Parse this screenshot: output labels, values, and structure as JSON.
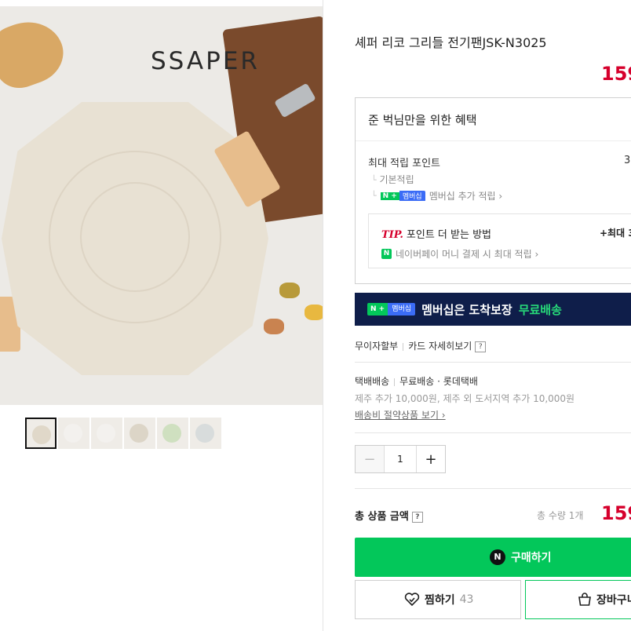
{
  "hero": {
    "brand_logo": "SSAPER"
  },
  "product": {
    "title": "셰퍼 리코 그리들 전기팬JSK-N3025",
    "price": "159"
  },
  "benefit": {
    "heading": "준 벅님만을 위한 혜택",
    "max_points_label": "최대 적립 포인트",
    "max_points_value": "3,",
    "basic_label": "기본적립",
    "npay_badge_n": "N +",
    "npay_badge_m": "멤버십",
    "membership_extra": "멤버십 추가 적립 ›",
    "tip_word": "TIP.",
    "tip_text": "포인트 더 받는 방법",
    "tip_value": "+최대 3",
    "tip_link": "네이버페이 머니 결제 시 최대 적립 ›"
  },
  "banner": {
    "badge_n": "N +",
    "badge_m": "멤버십",
    "text": "멤버십은 도착보장",
    "highlight": "무료배송"
  },
  "payment": {
    "installment": "무이자할부",
    "card_detail": "카드 자세히보기"
  },
  "shipping": {
    "method": "택배배송",
    "fee": "무료배송 · 롯데택배",
    "extra": "제주 추가 10,000원, 제주 외 도서지역 추가 10,000원",
    "saving_link": "배송비 절약상품 보기 ›"
  },
  "quantity": {
    "minus": "−",
    "value": "1",
    "plus": "+"
  },
  "total": {
    "label": "총 상품 금액",
    "qty_text": "총 수량 1개",
    "price": "159"
  },
  "actions": {
    "buy_label": "구매하기",
    "buy_icon_letter": "N",
    "wish_label": "찜하기",
    "wish_count": "43",
    "cart_label": "장바구니"
  },
  "colors": {
    "price_red": "#d6002c",
    "naver_green": "#03c75a",
    "banner_navy": "#0f1e4a"
  }
}
